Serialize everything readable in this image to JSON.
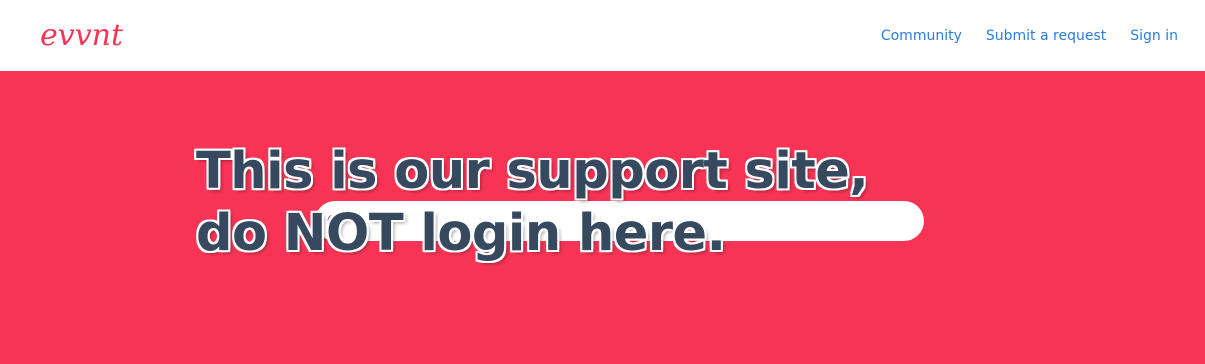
{
  "brand": {
    "logo_text": "evvnt",
    "color": "#f73455"
  },
  "nav": {
    "items": [
      {
        "label": "Community"
      },
      {
        "label": "Submit a request"
      },
      {
        "label": "Sign in"
      }
    ],
    "link_color": "#2b7de0"
  },
  "hero": {
    "background": "#f73455",
    "search_placeholder": "",
    "search_icon": "search-icon"
  },
  "overlay": {
    "line1": "This is our support site,",
    "line2": "do NOT login here.",
    "text_color": "#36495e"
  }
}
